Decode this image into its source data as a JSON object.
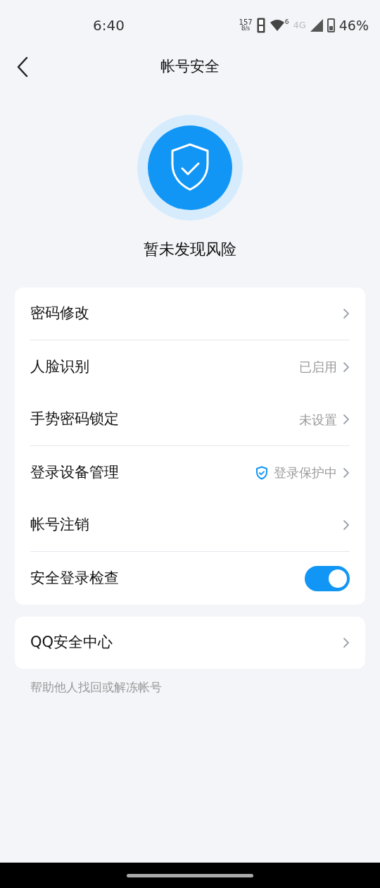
{
  "status_bar": {
    "time": "6:40",
    "speed": "157",
    "speed_unit": "B/s",
    "network": "4G",
    "wifi_badge": "6",
    "battery": "46%"
  },
  "header": {
    "title": "帐号安全"
  },
  "status": {
    "text": "暂未发现风险"
  },
  "settings": [
    {
      "kind": "link",
      "label": "密码修改",
      "divider_below": true
    },
    {
      "kind": "link",
      "label": "人脸识别",
      "value": "已启用",
      "divider_below": false
    },
    {
      "kind": "link",
      "label": "手势密码锁定",
      "value": "未设置",
      "divider_below": true
    },
    {
      "kind": "link",
      "label": "登录设备管理",
      "value": "登录保护中",
      "value_icon": true,
      "divider_below": false
    },
    {
      "kind": "link",
      "label": "帐号注销",
      "divider_below": true
    },
    {
      "kind": "toggle",
      "label": "安全登录检查",
      "on": true,
      "divider_below": false
    }
  ],
  "center": {
    "label": "QQ安全中心",
    "hint": "帮助他人找回或解冻帐号"
  }
}
